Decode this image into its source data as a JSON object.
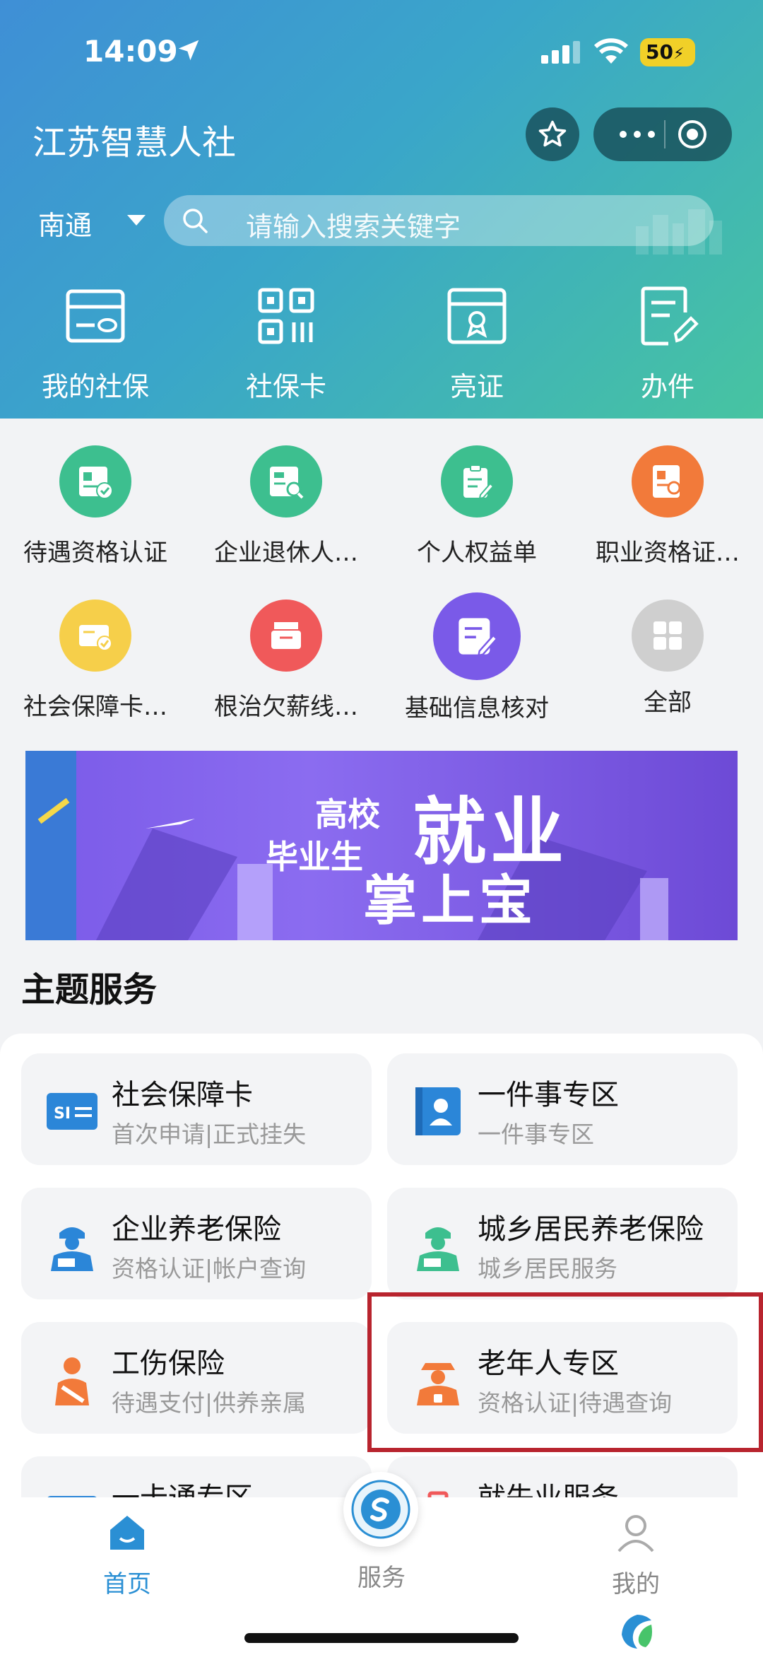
{
  "status_bar": {
    "time": "14:09",
    "battery": "50"
  },
  "header": {
    "title": "江苏智慧人社",
    "city": "南通",
    "search_placeholder": "请输入搜索关键字",
    "quick_actions": [
      {
        "label": "我的社保",
        "icon": "social-security-card-icon"
      },
      {
        "label": "社保卡",
        "icon": "qr-code-icon"
      },
      {
        "label": "亮证",
        "icon": "certificate-icon"
      },
      {
        "label": "办件",
        "icon": "edit-document-icon"
      }
    ]
  },
  "services": [
    {
      "label": "待遇资格认证",
      "icon": "id-check-icon",
      "color": "#3dbf8f"
    },
    {
      "label": "企业退休人…",
      "icon": "retiree-search-icon",
      "color": "#3dbf8f"
    },
    {
      "label": "个人权益单",
      "icon": "clipboard-edit-icon",
      "color": "#3dbf8f"
    },
    {
      "label": "职业资格证…",
      "icon": "certificate-search-icon",
      "color": "#f27a3a"
    },
    {
      "label": "社会保障卡…",
      "icon": "card-check-icon",
      "color": "#f6cf4a"
    },
    {
      "label": "根治欠薪线…",
      "icon": "wallet-icon",
      "color": "#f0595a"
    },
    {
      "label": "基础信息核对",
      "icon": "note-edit-icon",
      "color": "#7a5ae8"
    },
    {
      "label": "全部",
      "icon": "grid-icon",
      "color": "#cfcfcf"
    }
  ],
  "banner": {
    "line1": "高校",
    "line2": "毕业生",
    "line3": "就业",
    "line4": "掌上宝"
  },
  "topic_section": {
    "title": "主题服务",
    "cards": [
      {
        "title": "社会保障卡",
        "subtitle": "首次申请|正式挂失",
        "icon": "si-card-icon"
      },
      {
        "title": "一件事专区",
        "subtitle": "一件事专区",
        "icon": "person-book-icon"
      },
      {
        "title": "企业养老保险",
        "subtitle": "资格认证|帐户查询",
        "icon": "enterprise-worker-icon"
      },
      {
        "title": "城乡居民养老保险",
        "subtitle": "城乡居民服务",
        "icon": "resident-worker-icon"
      },
      {
        "title": "工伤保险",
        "subtitle": "待遇支付|供养亲属",
        "icon": "injury-icon"
      },
      {
        "title": "老年人专区",
        "subtitle": "资格认证|待遇查询",
        "icon": "elderly-icon"
      },
      {
        "title": "一卡通专区",
        "subtitle": "",
        "icon": "card-icon"
      },
      {
        "title": "就失业服务",
        "subtitle": "",
        "icon": "briefcase-icon"
      }
    ]
  },
  "tabbar": {
    "tabs": [
      {
        "label": "首页",
        "icon": "home-icon",
        "active": true
      },
      {
        "label": "服务",
        "icon": "service-logo-icon",
        "active": false
      },
      {
        "label": "我的",
        "icon": "profile-icon",
        "active": false
      }
    ]
  },
  "colors": {
    "accent": "#2a8fd4",
    "highlight": "#b8242e"
  }
}
